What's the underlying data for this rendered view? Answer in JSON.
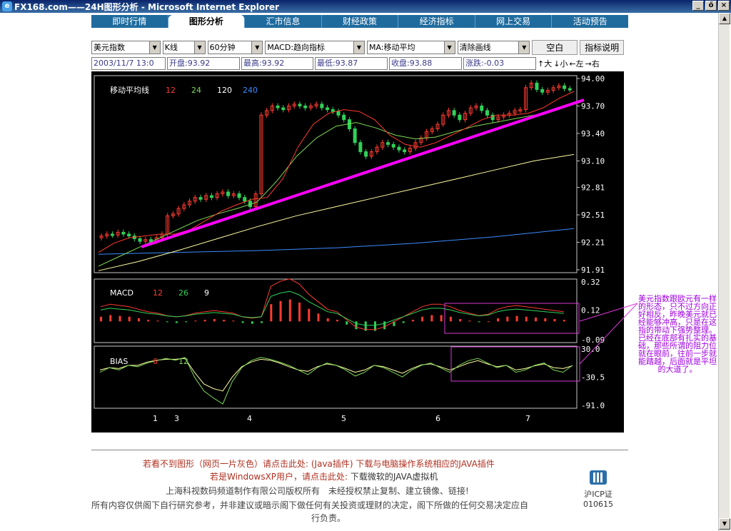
{
  "window": {
    "title": "FX168.com——24H图形分析 - Microsoft Internet Explorer",
    "min": "_",
    "restore": "ő",
    "close": "×"
  },
  "tabs": [
    "即时行情",
    "图形分析",
    "汇市信息",
    "财经政策",
    "经济指标",
    "网上交易",
    "活动预告"
  ],
  "toolbar": {
    "instrument": "美元指数",
    "chart_type": "K线",
    "period": "60分钟",
    "indicator1": "MACD:趋向指标",
    "indicator2": "MA:移动平均",
    "clear": "清除画线",
    "blank_label": "空白",
    "help_label": "指标说明"
  },
  "info": {
    "datetime": "2003/11/7 13:0",
    "open": "开盘:93.92",
    "high": "最高:93.92",
    "low": "最低:93.87",
    "close": "收盘:93.88",
    "change": "涨跌:-0.03",
    "zoom_in": "↑大",
    "zoom_out": "↓小",
    "left": "←左",
    "right": "→右"
  },
  "colors": {
    "tabbar": "#1f6b9e",
    "ma12": "#ff3b30",
    "ma24": "#7ed957",
    "ma120": "#fffca0",
    "ma240": "#3b8cff",
    "trend": "#ff00ff",
    "bull": "#ff3b30",
    "bear": "#30d158",
    "note": "#a000e0"
  },
  "chart_data": [
    {
      "type": "candlestick",
      "legend": {
        "title": "移动平均线",
        "labels": [
          "12",
          "24",
          "120",
          "240"
        ]
      },
      "y_ticks": [
        "94.00",
        "93.70",
        "93.40",
        "93.10",
        "92.81",
        "92.51",
        "92.21",
        "91.91"
      ],
      "ylim": [
        91.91,
        94.0
      ],
      "x_ticks": [
        "1",
        "3",
        "4",
        "5",
        "6",
        "7"
      ],
      "closes": [
        92.28,
        92.3,
        92.29,
        92.32,
        92.3,
        92.28,
        92.25,
        92.22,
        92.24,
        92.22,
        92.26,
        92.3,
        92.5,
        92.52,
        92.58,
        92.62,
        92.66,
        92.7,
        92.68,
        92.72,
        92.7,
        92.74,
        92.76,
        92.72,
        92.74,
        92.7,
        92.66,
        92.6,
        92.74,
        93.6,
        93.65,
        93.7,
        93.68,
        93.66,
        93.7,
        93.72,
        93.7,
        93.68,
        93.7,
        93.72,
        93.68,
        93.66,
        93.64,
        93.6,
        93.55,
        93.45,
        93.3,
        93.2,
        93.15,
        93.2,
        93.25,
        93.3,
        93.28,
        93.25,
        93.22,
        93.2,
        93.24,
        93.3,
        93.35,
        93.42,
        93.45,
        93.5,
        93.6,
        93.65,
        93.6,
        93.55,
        93.62,
        93.68,
        93.7,
        93.65,
        93.6,
        93.55,
        93.58,
        93.6,
        93.62,
        93.65,
        93.66,
        93.9,
        93.95,
        93.88,
        93.85,
        93.87,
        93.9,
        93.92,
        93.89,
        93.88
      ],
      "ma12": [
        92.1,
        92.2,
        92.26,
        92.28,
        92.3,
        92.3,
        92.35,
        92.45,
        92.55,
        92.62,
        92.68,
        92.7,
        92.9,
        93.25,
        93.5,
        93.62,
        93.66,
        93.64,
        93.55,
        93.38,
        93.28,
        93.25,
        93.3,
        93.38,
        93.46,
        93.55,
        93.6,
        93.6,
        93.62,
        93.68,
        93.78,
        93.86
      ],
      "ma24": [
        91.95,
        92.05,
        92.15,
        92.25,
        92.35,
        92.45,
        92.52,
        92.58,
        92.65,
        92.88,
        93.15,
        93.35,
        93.48,
        93.52,
        93.46,
        93.38,
        93.34,
        93.36,
        93.42,
        93.48,
        93.52,
        93.56,
        93.6,
        93.65,
        93.72
      ],
      "ma120": [
        91.9,
        92.0,
        92.12,
        92.25,
        92.38,
        92.5,
        92.6,
        92.7,
        92.8,
        92.9,
        93.0,
        93.1,
        93.17
      ],
      "ma240": [
        92.08,
        92.1,
        92.12,
        92.15,
        92.2,
        92.27,
        92.36
      ]
    },
    {
      "type": "bar",
      "name": "MACD",
      "legend": {
        "title": "MACD",
        "labels": [
          "12",
          "26",
          "9"
        ]
      },
      "y_ticks": [
        "0.32",
        "0.12",
        "-0.09"
      ],
      "histogram": [
        0.03,
        0.04,
        0.035,
        0.03,
        0.02,
        0.01,
        0.005,
        -0.005,
        -0.01,
        -0.005,
        0.005,
        0.01,
        0.015,
        0.01,
        0.005,
        -0.01,
        -0.015,
        -0.01,
        0.11,
        0.13,
        0.14,
        0.12,
        0.08,
        0.05,
        0.02,
        0.01,
        -0.02,
        -0.05,
        -0.06,
        -0.06,
        -0.05,
        -0.03,
        -0.01,
        0.01,
        0.03,
        0.04,
        0.04,
        0.03,
        0.015,
        0.005,
        -0.005,
        0.0,
        0.02,
        0.03,
        0.035,
        0.03,
        0.025,
        0.02,
        0.015,
        0.01
      ]
    },
    {
      "type": "line",
      "name": "BIAS",
      "legend": {
        "title": "BIAS",
        "labels": [
          "6",
          "12"
        ]
      },
      "y_ticks": [
        "30.0",
        "-30.5",
        "-91.0"
      ],
      "bias6": [
        -20,
        -10,
        -15,
        -5,
        -8,
        0,
        5,
        10,
        6,
        12,
        -30,
        -60,
        -75,
        -88,
        -40,
        -10,
        5,
        12,
        8,
        2,
        -5,
        -15,
        -25,
        -10,
        0,
        -5,
        -15,
        -28,
        -20,
        -5,
        -10,
        -20,
        -30,
        -15,
        -5,
        0,
        -10,
        -20,
        -5,
        5,
        10,
        0,
        -10,
        -5,
        -20,
        -15,
        -5,
        0,
        -15,
        -20,
        -5
      ],
      "bias12": [
        -15,
        -10,
        -12,
        -5,
        -5,
        2,
        6,
        8,
        8,
        10,
        -20,
        -45,
        -55,
        -60,
        -30,
        -8,
        2,
        8,
        6,
        0,
        -8,
        -15,
        -18,
        -8,
        -2,
        -5,
        -12,
        -20,
        -15,
        -5,
        -8,
        -15,
        -22,
        -12,
        -4,
        -2,
        -8,
        -15,
        -8,
        0,
        5,
        -2,
        -8,
        -5,
        -15,
        -12,
        -6,
        -2,
        -10,
        -12,
        -6
      ]
    }
  ],
  "note": "美元指数跟欧元有一样的形态，只不过方向正好相反，昨晚美元就已经能够冲高，只是在这指的带动下强势整理。已经在底部有扎实的基础，那些所谓的阻力位就在眼前，往前一步就能踏越，后面就是平坦的大道了。",
  "footer": {
    "line1_a": "若看不到图形（网页一片灰色）请点击此处:",
    "line1_b": "(Java插件) 下载与电脑操作系统相应的JAVA插件",
    "line2_a": "若是WindowsXP用户，请点击此处:",
    "line2_b": "下载微软的JAVA虚拟机",
    "line3": "上海科视数码频道制作有限公司版权所有　未经授权禁止复制、建立镜像、链接!",
    "line4": "所有内容仅供阁下自行研究参考，并非建议或暗示阁下做任何有关投资或理财的决定，阁下所做的任何交易决定应自",
    "line5": "行负责。",
    "icp_label": "沪ICP证",
    "icp_number": "010615"
  }
}
